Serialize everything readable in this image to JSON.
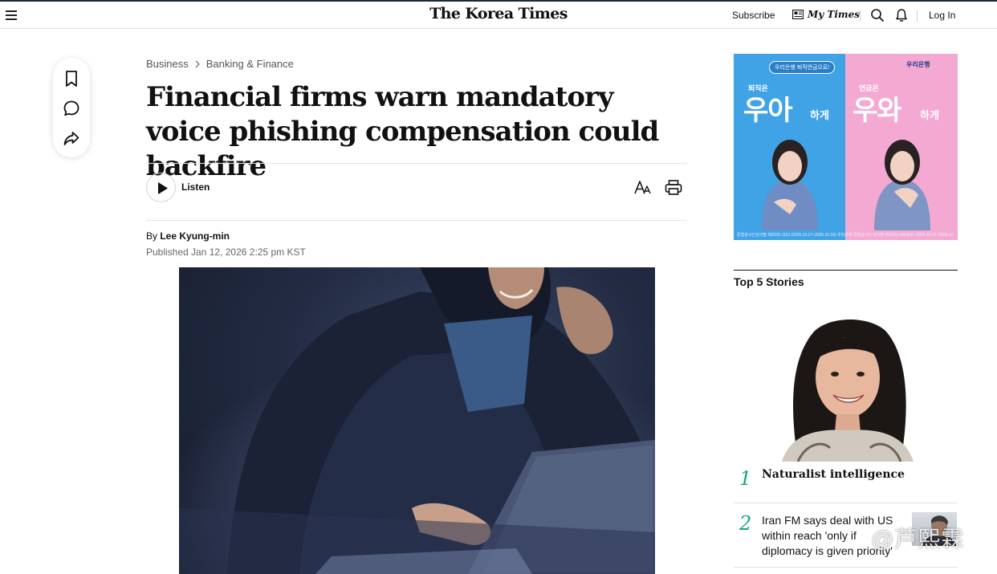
{
  "header": {
    "logo": "The Korea Times",
    "subscribe_label": "Subscribe",
    "my_times_label": "My Times",
    "login_label": "Log In"
  },
  "breadcrumb": {
    "section": "Business",
    "subsection": "Banking & Finance"
  },
  "article": {
    "headline": "Financial firms warn mandatory voice phishing compensation could backfire",
    "listen_label": "Listen",
    "byline_prefix": "By ",
    "author": "Lee Kyung-min",
    "published": "Published Jan 12, 2026 2:25 pm KST"
  },
  "ad": {
    "pill_text": "우리은행 퇴직연금으로!",
    "brand": "우리은행",
    "left_small": "퇴직은",
    "left_big": "우아",
    "left_suffix": "하게",
    "right_small": "연금은",
    "right_big": "우와",
    "right_suffix": "하게",
    "fine_print": "준법감시인심의필 제2025-1110 (2025.10.17~2026.10.16) 우리은행 준법감시인 심의필 제2025-04096호 (2025.10.17~2026.10.16)"
  },
  "top_stories": {
    "title": "Top 5 Stories",
    "items": [
      {
        "rank": "1",
        "title": "Naturalist intelligence"
      },
      {
        "rank": "2",
        "title": "Iran FM says deal with US within reach 'only if diplomacy is given priority'"
      }
    ]
  },
  "watermark": "@芦熙霖",
  "colors": {
    "accent_green": "#1aa873",
    "top_border": "#1c2740",
    "ad_blue": "#3fa3e6",
    "ad_pink": "#f4a9d3"
  }
}
